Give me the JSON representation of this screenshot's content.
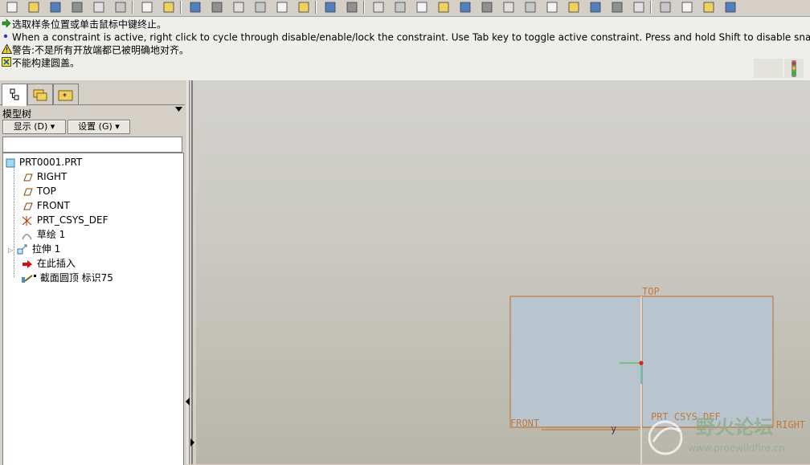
{
  "toolbar": {
    "items": [
      "new-file-icon",
      "open-file-icon",
      "save-icon",
      "print-icon",
      "send-file-icon",
      "mail-icon",
      "undo-icon",
      "redo-icon",
      "cut-icon",
      "copy-icon",
      "paste-icon",
      "paste-special-icon",
      "regenerate-icon",
      "regen-manager-icon",
      "search-icon",
      "select-box-icon",
      "sketch-icon",
      "datum-point-icon",
      "spin-center-icon",
      "layers-icon",
      "shading-icon",
      "zoom-in-icon",
      "zoom-out-icon",
      "refit-icon",
      "orient-icon",
      "saved-views-icon",
      "layer-tree-icon",
      "display-style-icon",
      "datum-display-icon",
      "view-front-icon",
      "view-back-icon",
      "view-side-icon",
      "view-top-icon"
    ]
  },
  "messages": {
    "line1": "选取样条位置或单击鼠标中键终止。",
    "line2": "When a constraint is active, right click to cycle through disable/enable/lock the constraint. Use Tab key to toggle active constraint. Press and hold Shift to disable snapping to c",
    "line3": "警告:不是所有开放端都已被明确地对齐。",
    "line4": "不能构建圆盖。"
  },
  "left_panel": {
    "tabs": [
      "model-tree-tab",
      "folder-browser-tab",
      "favorites-tab"
    ],
    "title": "模型树",
    "display_button": "显示 (D)",
    "settings_button": "设置 (G)",
    "tree": {
      "root": "PRT0001.PRT",
      "items": [
        "RIGHT",
        "TOP",
        "FRONT",
        "PRT_CSYS_DEF",
        "草绘 1",
        "拉伸 1",
        "在此插入",
        "截面圆顶 标识75"
      ]
    }
  },
  "graphics": {
    "labels": {
      "top": "TOP",
      "front": "FRONT",
      "csys": "PRT_CSYS_DEF",
      "right": "RIGHT",
      "y_axis": "y"
    },
    "watermark": {
      "title": "野火论坛",
      "url": "www.proewildfire.cn"
    },
    "colors": {
      "plane_fill": "#b8c4ce",
      "plane_edge": "#c07a3c",
      "background": "#c9c8c1"
    }
  }
}
